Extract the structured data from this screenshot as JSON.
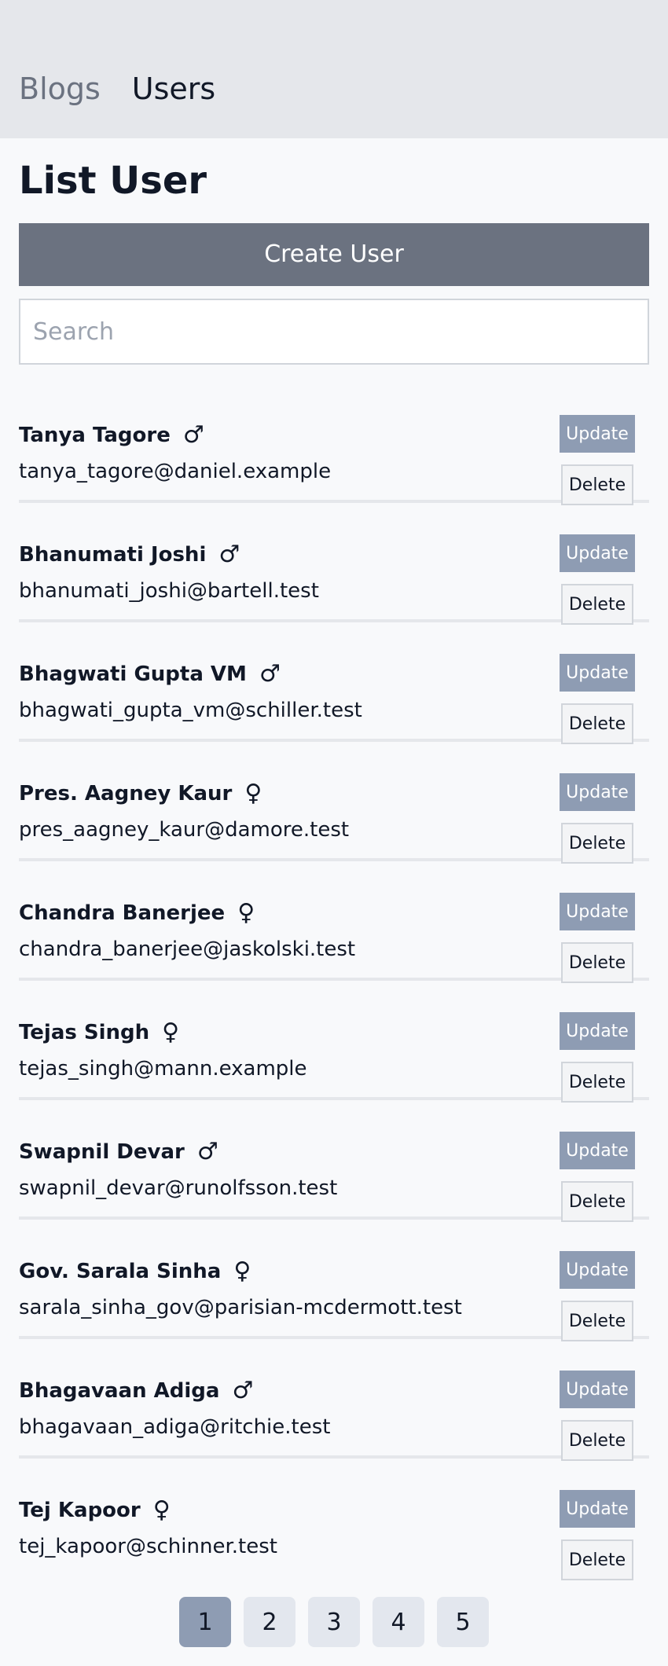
{
  "nav": {
    "items": [
      {
        "label": "Blogs",
        "active": false
      },
      {
        "label": "Users",
        "active": true
      }
    ]
  },
  "page": {
    "title": "List User",
    "create_label": "Create User",
    "search_placeholder": "Search",
    "search_value": ""
  },
  "row_actions": {
    "update_label": "Update",
    "delete_label": "Delete"
  },
  "users": [
    {
      "name": "Tanya Tagore",
      "gender": "male",
      "gender_symbol": "♂",
      "email": "tanya_tagore@daniel.example"
    },
    {
      "name": "Bhanumati Joshi",
      "gender": "male",
      "gender_symbol": "♂",
      "email": "bhanumati_joshi@bartell.test"
    },
    {
      "name": "Bhagwati Gupta VM",
      "gender": "male",
      "gender_symbol": "♂",
      "email": "bhagwati_gupta_vm@schiller.test"
    },
    {
      "name": "Pres. Aagney Kaur",
      "gender": "female",
      "gender_symbol": "♀",
      "email": "pres_aagney_kaur@damore.test"
    },
    {
      "name": "Chandra Banerjee",
      "gender": "female",
      "gender_symbol": "♀",
      "email": "chandra_banerjee@jaskolski.test"
    },
    {
      "name": "Tejas Singh",
      "gender": "female",
      "gender_symbol": "♀",
      "email": "tejas_singh@mann.example"
    },
    {
      "name": "Swapnil Devar",
      "gender": "male",
      "gender_symbol": "♂",
      "email": "swapnil_devar@runolfsson.test"
    },
    {
      "name": "Gov. Sarala Sinha",
      "gender": "female",
      "gender_symbol": "♀",
      "email": "sarala_sinha_gov@parisian-mcdermott.test"
    },
    {
      "name": "Bhagavaan Adiga",
      "gender": "male",
      "gender_symbol": "♂",
      "email": "bhagavaan_adiga@ritchie.test"
    },
    {
      "name": "Tej Kapoor",
      "gender": "female",
      "gender_symbol": "♀",
      "email": "tej_kapoor@schinner.test"
    }
  ],
  "pagination": {
    "pages": [
      "1",
      "2",
      "3",
      "4",
      "5"
    ],
    "current": "1"
  },
  "colors": {
    "update_button": "#8e9cb3",
    "create_button": "#6b7280",
    "active_page": "#8e9cb3"
  }
}
